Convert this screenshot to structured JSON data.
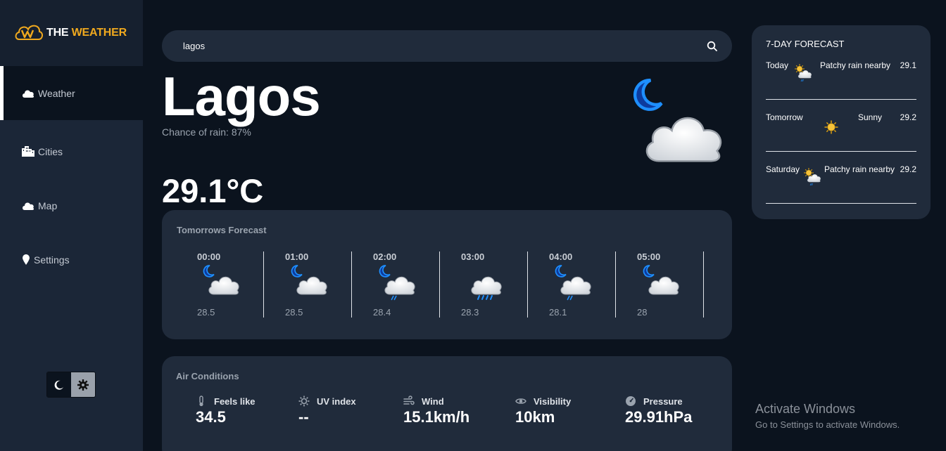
{
  "brand": {
    "the": "THE",
    "weather": "WEATHER"
  },
  "nav": [
    {
      "label": "Weather",
      "icon": "cloud-icon"
    },
    {
      "label": "Cities",
      "icon": "city-icon"
    },
    {
      "label": "Map",
      "icon": "cloud-icon"
    },
    {
      "label": "Settings",
      "icon": "pin-icon"
    }
  ],
  "search": {
    "value": "lagos"
  },
  "current": {
    "city": "Lagos",
    "rain_chance": "Chance of rain: 87%",
    "temperature": "29.1°C"
  },
  "tomorrow": {
    "title": "Tomorrows Forecast",
    "hours": [
      {
        "time": "00:00",
        "temp": "28.5",
        "icon": "moon-cloud-icon"
      },
      {
        "time": "01:00",
        "temp": "28.5",
        "icon": "moon-cloud-icon"
      },
      {
        "time": "02:00",
        "temp": "28.4",
        "icon": "moon-rain-icon"
      },
      {
        "time": "03:00",
        "temp": "28.3",
        "icon": "cloud-rain-icon"
      },
      {
        "time": "04:00",
        "temp": "28.1",
        "icon": "moon-rain-icon"
      },
      {
        "time": "05:00",
        "temp": "28",
        "icon": "moon-cloud-icon"
      }
    ]
  },
  "air": {
    "title": "Air Conditions",
    "metrics": [
      {
        "label": "Feels like",
        "value": "34.5",
        "icon": "thermometer-icon"
      },
      {
        "label": "UV index",
        "value": "--",
        "icon": "sun-icon"
      },
      {
        "label": "Wind",
        "value": "15.1km/h",
        "icon": "wind-icon"
      },
      {
        "label": "Visibility",
        "value": "10km",
        "icon": "eye-icon"
      },
      {
        "label": "Pressure",
        "value": "29.91hPa",
        "icon": "gauge-icon"
      }
    ]
  },
  "weekly": {
    "title": "7-DAY FORECAST",
    "days": [
      {
        "day": "Today",
        "condition": "Patchy rain nearby",
        "temp": "29.1",
        "icon": "sun-rain-icon"
      },
      {
        "day": "Tomorrow",
        "condition": "Sunny",
        "temp": "29.2",
        "icon": "sun-icon"
      },
      {
        "day": "Saturday",
        "condition": "Patchy rain nearby",
        "temp": "29.2",
        "icon": "sun-rain-icon"
      }
    ]
  },
  "watermark": {
    "title": "Activate Windows",
    "subtitle": "Go to Settings to activate Windows."
  },
  "colors": {
    "accent": "#f0a91e",
    "card": "#202b3b",
    "sidebar": "#1b2637",
    "background": "#0b131e"
  }
}
